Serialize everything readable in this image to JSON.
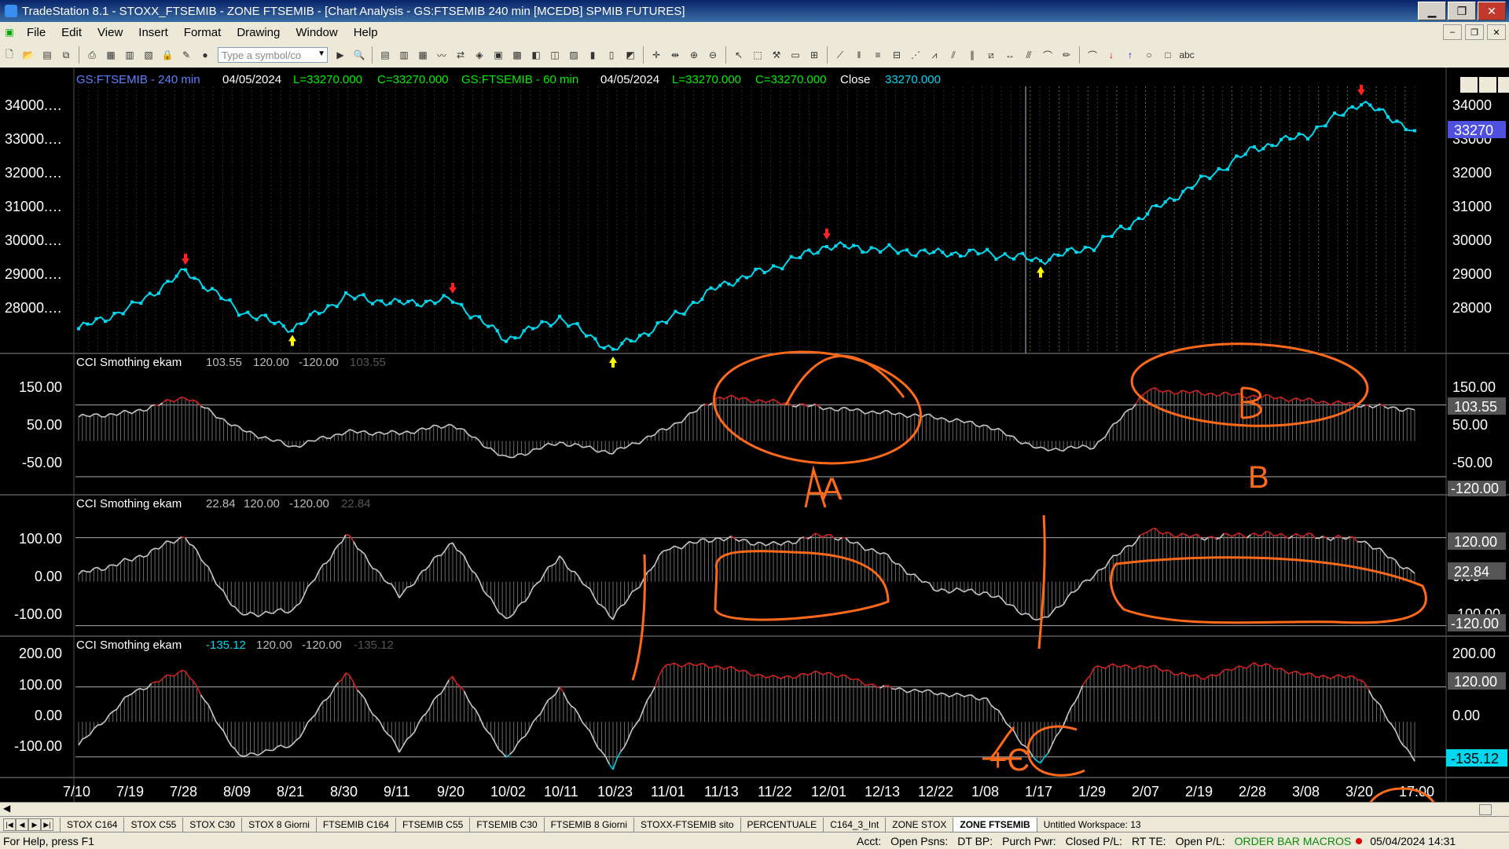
{
  "window": {
    "title": "TradeStation 8.1 - STOXX_FTSEMIB - ZONE FTSEMIB - [Chart Analysis - GS:FTSEMIB  240 min  [MCEDB] SPMIB FUTURES]",
    "minimize": "▁",
    "restore": "❐",
    "close": "✕"
  },
  "menu": {
    "items": [
      "File",
      "Edit",
      "View",
      "Insert",
      "Format",
      "Drawing",
      "Window",
      "Help"
    ],
    "mdi_min": "–",
    "mdi_restore": "❐",
    "mdi_close": "✕"
  },
  "toolbar": {
    "symbol_placeholder": "Type a symbol/co"
  },
  "chart": {
    "header": {
      "sym1": "GS:FTSEMIB - 240 min",
      "date1": "04/05/2024",
      "l1": "L=33270.000",
      "c1": "C=33270.000",
      "sym2": "GS:FTSEMIB - 60 min",
      "date2": "04/05/2024",
      "l2": "L=33270.000",
      "c2": "C=33270.000",
      "close_label": "Close",
      "close_value": "33270.000"
    },
    "price_axis_left": [
      "34000.…",
      "33000.…",
      "32000.…",
      "31000.…",
      "30000.…",
      "29000.…",
      "28000.…"
    ],
    "price_axis_right": [
      "34000",
      "33000",
      "32000",
      "31000",
      "30000",
      "29000",
      "28000"
    ],
    "price_last_badge": "33270",
    "panel1": {
      "name": "CCI Smothing ekam",
      "v1": "103.55",
      "v2": "120.00",
      "v3": "-120.00",
      "v4": "103.55",
      "axis_left": [
        "150.00",
        "50.00",
        "-50.00"
      ],
      "axis_right": [
        "150.00",
        "50.00",
        "-50.00"
      ],
      "badge_val": "103.55",
      "badge_neg": "-120.00",
      "annotation": "A",
      "annotation2": "B"
    },
    "panel2": {
      "name": "CCI Smothing ekam",
      "v1": "22.84",
      "v2": "120.00",
      "v3": "-120.00",
      "v4": "22.84",
      "axis_left": [
        "100.00",
        "0.00",
        "-100.00"
      ],
      "axis_right": [
        "100.00",
        "0.00",
        "-100.00"
      ],
      "badge_pos": "120.00",
      "badge_val": "22.84",
      "badge_neg": "-120.00"
    },
    "panel3": {
      "name": "CCI Smothing ekam",
      "v1": "-135.12",
      "v2": "120.00",
      "v3": "-120.00",
      "v4": "-135.12",
      "axis_left": [
        "200.00",
        "100.00",
        "0.00",
        "-100.00"
      ],
      "axis_right": [
        "200.00",
        "100.00",
        "0.00",
        "-100.00"
      ],
      "badge_pos": "120.00",
      "badge_val": "-135.12",
      "annotation": "+C"
    },
    "x_axis": [
      "7/10",
      "7/19",
      "7/28",
      "8/09",
      "8/21",
      "8/30",
      "9/11",
      "9/20",
      "10/02",
      "10/11",
      "10/23",
      "11/01",
      "11/13",
      "11/22",
      "12/01",
      "12/13",
      "12/22",
      "1/08",
      "1/17",
      "1/29",
      "2/07",
      "2/19",
      "2/28",
      "3/08",
      "3/20",
      "17:00"
    ]
  },
  "tabs": [
    "STOX C164",
    "STOX C55",
    "STOX  C30",
    "STOX  8 Giorni",
    "FTSEMIB C164",
    "FTSEMIB C55",
    "FTSEMIB C30",
    "FTSEMIB  8 Giorni",
    "STOXX-FTSEMIB sito",
    "PERCENTUALE",
    "C164_3_Int",
    "ZONE STOX",
    "ZONE FTSEMIB",
    "Untitled Workspace:  13"
  ],
  "active_tab": "ZONE FTSEMIB",
  "status": {
    "help": "For Help, press F1",
    "acct": "Acct:",
    "open_psns": "Open Psns:",
    "dt_bp": "DT BP:",
    "purch_pwr": "Purch Pwr:",
    "closed_pl": "Closed P/L:",
    "rt_te": "RT TE:",
    "open_pl": "Open P/L:",
    "order_bar": "ORDER BAR  MACROS",
    "datetime": "05/04/2024 14:31"
  },
  "colors": {
    "price": "#00d8f0",
    "cci_line": "#a0a0a0",
    "cci_high": "#d02020",
    "cci_low": "#00c8e0",
    "annotation": "#ff6a1a",
    "header_blue": "#6080ff",
    "header_green": "#00ee00",
    "arrow_down": "#ff2020",
    "arrow_up": "#ffff00"
  },
  "chart_data": {
    "type": "line",
    "title": "GS:FTSEMIB - 240 min",
    "x": [
      "7/10",
      "7/19",
      "7/28",
      "8/09",
      "8/21",
      "8/30",
      "9/11",
      "9/20",
      "10/02",
      "10/11",
      "10/23",
      "11/01",
      "11/13",
      "11/22",
      "12/01",
      "12/13",
      "12/22",
      "1/08",
      "1/17",
      "1/29",
      "2/07",
      "2/19",
      "2/28",
      "3/08",
      "3/20",
      "17:00"
    ],
    "series": [
      {
        "values": [
          27800,
          28400,
          29400,
          28300,
          27800,
          28700,
          28500,
          28600,
          27500,
          28100,
          27200,
          28000,
          29000,
          29500,
          30100,
          30000,
          29900,
          29900,
          29700,
          30100,
          31000,
          31900,
          32800,
          33200,
          34100,
          33300
        ]
      },
      {
        "values": [
          80,
          95,
          148,
          40,
          -20,
          30,
          25,
          55,
          -60,
          -5,
          -40,
          40,
          148,
          130,
          110,
          95,
          80,
          50,
          -30,
          -20,
          170,
          160,
          150,
          135,
          120,
          103.55
        ]
      },
      {
        "values": [
          20,
          60,
          125,
          -90,
          -80,
          130,
          -40,
          110,
          -110,
          70,
          -100,
          90,
          120,
          100,
          130,
          80,
          -20,
          -30,
          -110,
          20,
          140,
          120,
          130,
          125,
          115,
          22.84
        ]
      },
      {
        "values": [
          -80,
          100,
          180,
          -120,
          -80,
          170,
          -100,
          160,
          -130,
          120,
          -160,
          200,
          190,
          150,
          170,
          120,
          100,
          80,
          -150,
          190,
          190,
          150,
          200,
          160,
          150,
          -135.12
        ]
      }
    ],
    "ylim": [
      27200,
      34400
    ],
    "grid": true
  }
}
